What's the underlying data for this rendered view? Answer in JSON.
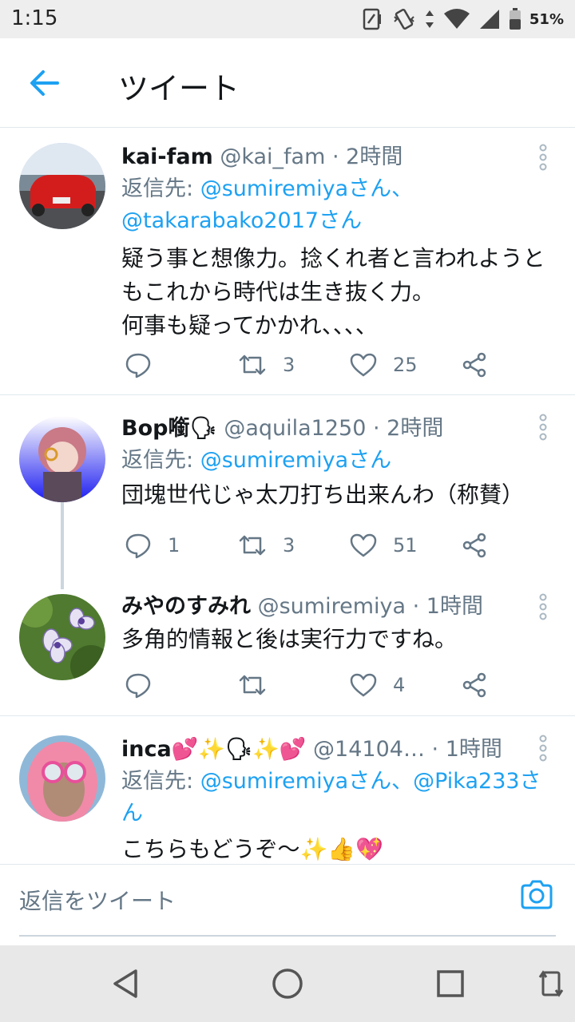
{
  "status": {
    "time": "1:15",
    "battery": "51%"
  },
  "header": {
    "title": "ツイート"
  },
  "tweets": [
    {
      "name": "kai-fam",
      "handle": "@kai_fam",
      "time": "· 2時間",
      "reply_prefix": "返信先: ",
      "reply_to": "@sumiremiyaさん、\n@takarabako2017さん",
      "text": "疑う事と想像力。捻くれ者と言われようともこれから時代は生き抜く力。\n何事も疑ってかかれ、、、、",
      "replies": "",
      "retweets": "3",
      "likes": "25"
    },
    {
      "name": "Bop㘅🗣",
      "handle": "@aquila1250",
      "time": "· 2時間",
      "reply_prefix": "返信先: ",
      "reply_to": "@sumiremiyaさん",
      "text": "団塊世代じゃ太刀打ち出来んわ（称賛）",
      "replies": "1",
      "retweets": "3",
      "likes": "51"
    },
    {
      "name": "みやのすみれ",
      "handle": "@sumiremiya",
      "time": "· 1時間",
      "text": "多角的情報と後は実行力ですね。",
      "replies": "",
      "retweets": "",
      "likes": "4"
    },
    {
      "name": "inca💕✨🗣✨💕",
      "handle": "@14104…",
      "time": "· 1時間",
      "reply_prefix": "返信先: ",
      "reply_to": "@sumiremiyaさん、@Pika233さん",
      "text": "こちらもどうぞ〜✨👍💖"
    }
  ],
  "composer": {
    "placeholder": "返信をツイート"
  },
  "colors": {
    "accent": "#1da1f2",
    "secondary_text": "#657786",
    "divider": "#e1e8ed"
  }
}
